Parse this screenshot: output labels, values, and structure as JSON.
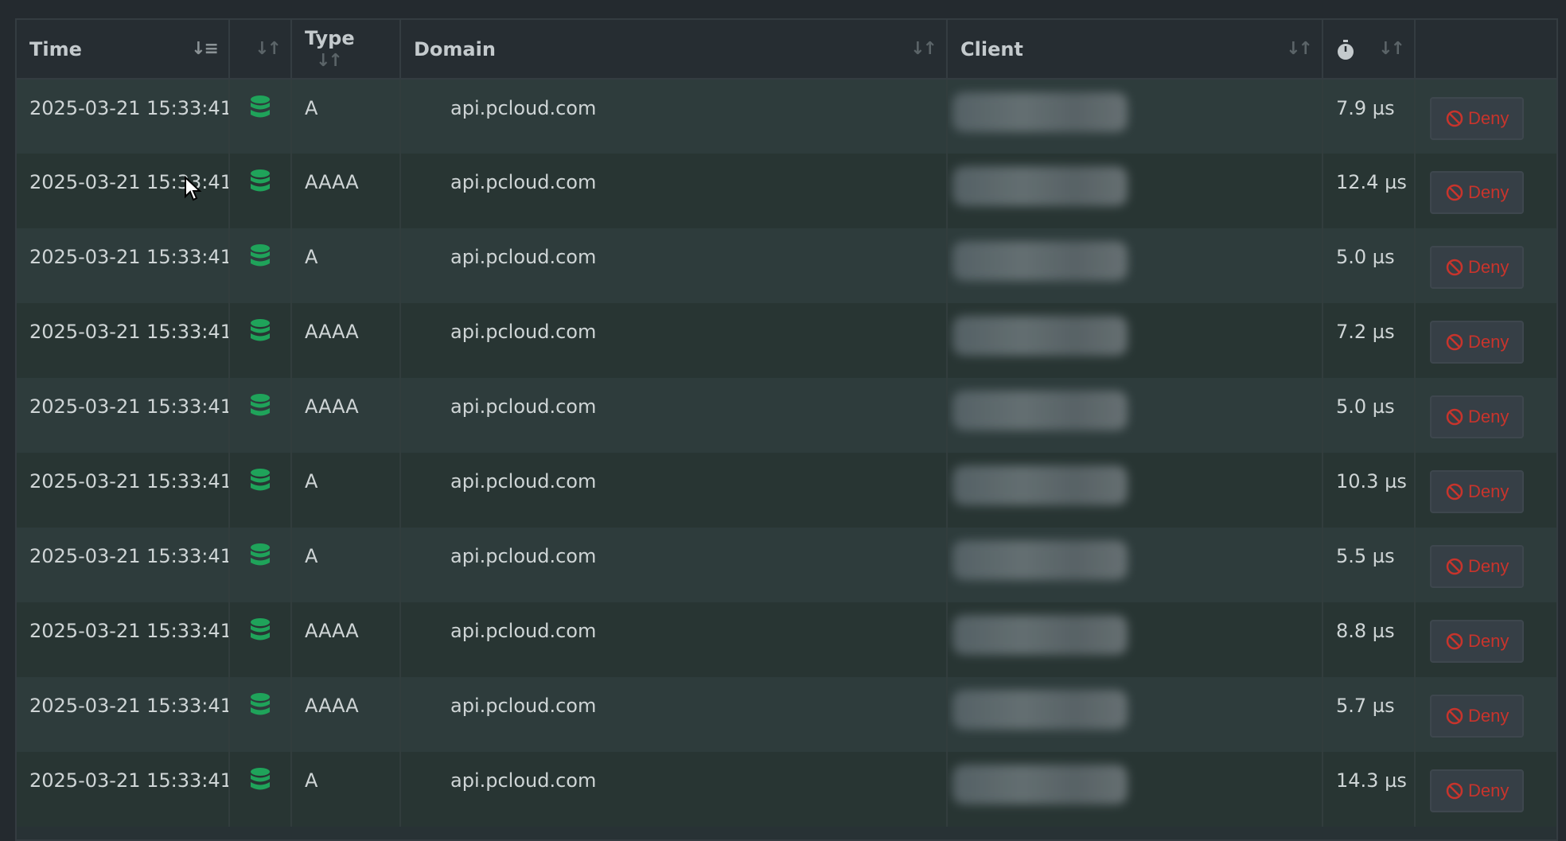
{
  "columns": {
    "time": "Time",
    "type": "Type",
    "domain": "Domain",
    "client": "Client",
    "duration_icon": "timer-icon"
  },
  "colors": {
    "status_green": "#1fa35a",
    "deny_red": "#c8342c"
  },
  "deny_label": "Deny",
  "rows": [
    {
      "time": "2025-03-21 15:33:41",
      "type": "A",
      "domain": "api.pcloud.com",
      "duration": "7.9 µs"
    },
    {
      "time": "2025-03-21 15:33:41",
      "type": "AAAA",
      "domain": "api.pcloud.com",
      "duration": "12.4 µs"
    },
    {
      "time": "2025-03-21 15:33:41",
      "type": "A",
      "domain": "api.pcloud.com",
      "duration": "5.0 µs"
    },
    {
      "time": "2025-03-21 15:33:41",
      "type": "AAAA",
      "domain": "api.pcloud.com",
      "duration": "7.2 µs"
    },
    {
      "time": "2025-03-21 15:33:41",
      "type": "AAAA",
      "domain": "api.pcloud.com",
      "duration": "5.0 µs"
    },
    {
      "time": "2025-03-21 15:33:41",
      "type": "A",
      "domain": "api.pcloud.com",
      "duration": "10.3 µs"
    },
    {
      "time": "2025-03-21 15:33:41",
      "type": "A",
      "domain": "api.pcloud.com",
      "duration": "5.5 µs"
    },
    {
      "time": "2025-03-21 15:33:41",
      "type": "AAAA",
      "domain": "api.pcloud.com",
      "duration": "8.8 µs"
    },
    {
      "time": "2025-03-21 15:33:41",
      "type": "AAAA",
      "domain": "api.pcloud.com",
      "duration": "5.7 µs"
    },
    {
      "time": "2025-03-21 15:33:41",
      "type": "A",
      "domain": "api.pcloud.com",
      "duration": "14.3 µs"
    }
  ]
}
